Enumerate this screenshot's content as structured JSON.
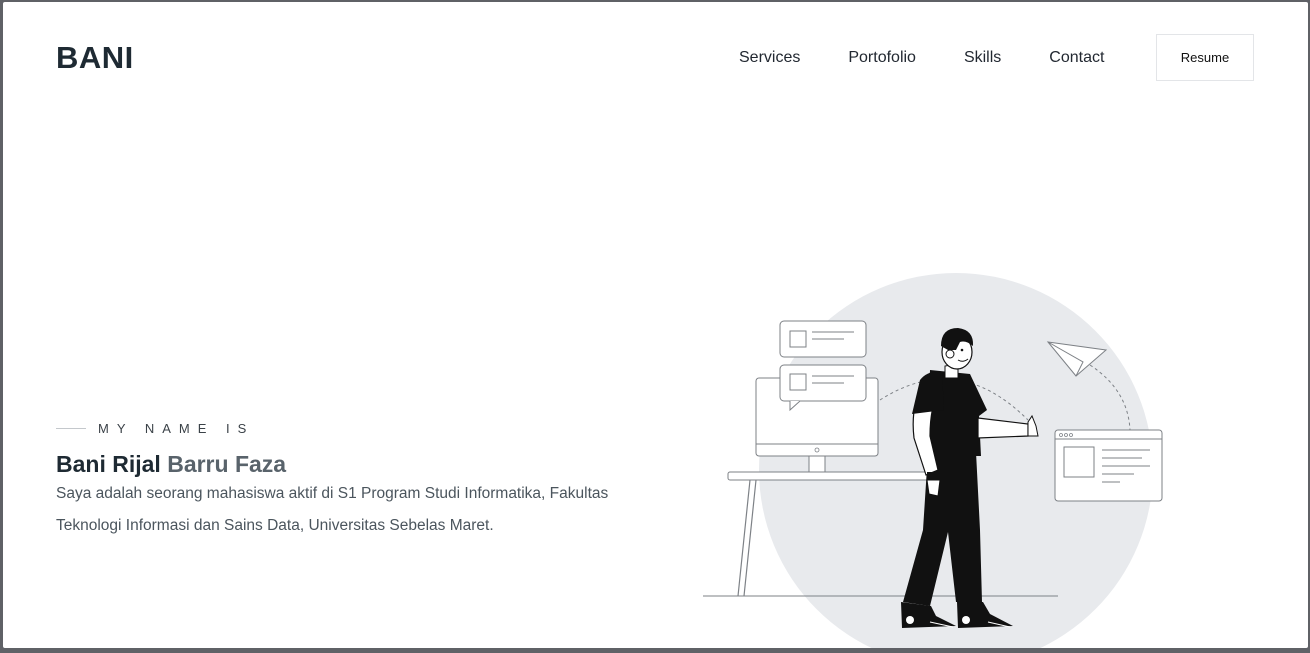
{
  "header": {
    "logo": "BANI",
    "nav": [
      {
        "label": "Services"
      },
      {
        "label": "Portofolio"
      },
      {
        "label": "Skills"
      },
      {
        "label": "Contact"
      }
    ],
    "resume_label": "Resume"
  },
  "hero": {
    "eyebrow": "MY NAME IS",
    "name_first": "Bani Rijal",
    "name_rest": "Barru Faza",
    "description": "Saya adalah seorang mahasiswa aktif di S1 Program Studi Informatika, Fakultas Teknologi Informasi dan Sains Data, Universitas Sebelas Maret."
  },
  "colors": {
    "background": "#ffffff",
    "text_dark": "#1e2a33",
    "text_muted": "#59636b",
    "illustration_circle": "#e8eaed"
  },
  "icons": {
    "illustration": "man-thumbs-up-illustration"
  }
}
